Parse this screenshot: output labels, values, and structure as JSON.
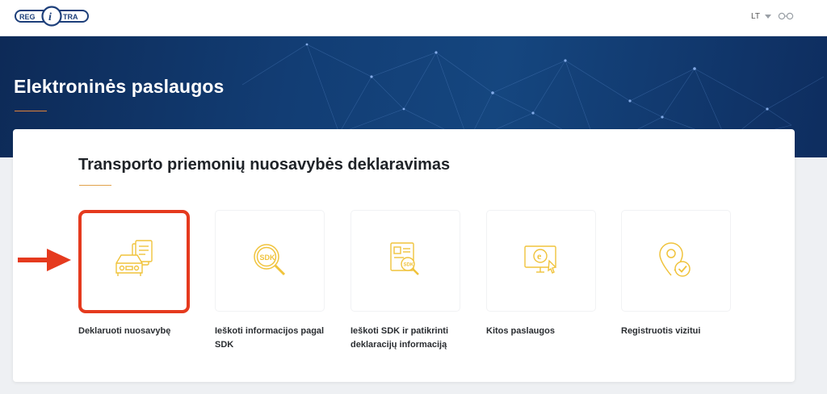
{
  "header": {
    "logo_text": "REGITRA",
    "language": "LT",
    "language_icon": "chevron-down-icon",
    "accessibility_icon": "glasses-icon"
  },
  "hero": {
    "title": "Elektroninės paslaugos"
  },
  "section": {
    "title": "Transporto priemonių nuosavybės deklaravimas",
    "services": [
      {
        "label": "Deklaruoti nuosavybę",
        "icon": "car-document-icon",
        "highlighted": true
      },
      {
        "label": "Ieškoti informacijos pagal SDK",
        "icon": "sdk-search-icon",
        "highlighted": false
      },
      {
        "label": "Ieškoti SDK ir patikrinti deklaracijų informaciją",
        "icon": "document-sdk-search-icon",
        "highlighted": false
      },
      {
        "label": "Kitos paslaugos",
        "icon": "computer-e-service-icon",
        "highlighted": false
      },
      {
        "label": "Registruotis vizitui",
        "icon": "location-check-icon",
        "highlighted": false
      }
    ]
  },
  "colors": {
    "hero_dark": "#0d2a57",
    "accent_orange": "#e0823a",
    "icon_gold": "#f0c33c",
    "highlight_red": "#e53a1e"
  }
}
